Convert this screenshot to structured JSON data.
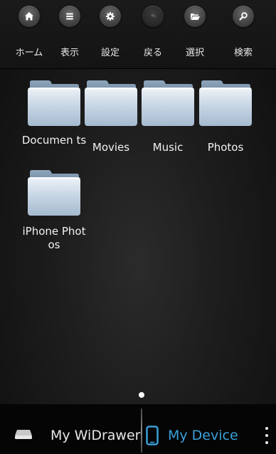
{
  "toolbar": {
    "items": [
      {
        "label": "ホーム",
        "icon": "home-icon"
      },
      {
        "label": "表示",
        "icon": "list-view-icon"
      },
      {
        "label": "設定",
        "icon": "gear-icon"
      },
      {
        "label": "戻る",
        "icon": "undo-icon"
      },
      {
        "label": "選択",
        "icon": "folder-open-icon"
      },
      {
        "label": "検索",
        "icon": "search-icon"
      }
    ]
  },
  "folders": [
    {
      "name": "Documents",
      "display": "Documen ts"
    },
    {
      "name": "Movies",
      "display": "Movies"
    },
    {
      "name": "Music",
      "display": "Music"
    },
    {
      "name": "Photos",
      "display": "Photos"
    },
    {
      "name": "iPhone Photos",
      "display": "iPhone Photos"
    }
  ],
  "pager": {
    "current_page": 1,
    "total_pages": 1
  },
  "bottom_bar": {
    "widrawer_label": "My WiDrawer",
    "device_label": "My Device",
    "active_tab": "My Device",
    "active_color": "#3aa0d8"
  }
}
